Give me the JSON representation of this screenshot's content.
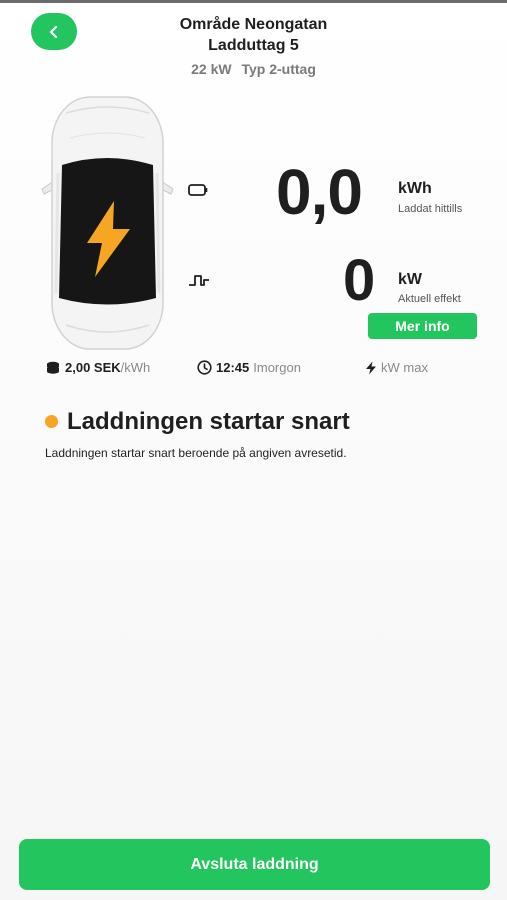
{
  "header": {
    "area": "Område Neongatan",
    "outlet": "Ladduttag 5",
    "power": "22 kW",
    "connector": "Typ 2-uttag"
  },
  "icons": {
    "back": "chevron-left-icon",
    "charged": "battery-icon",
    "power": "pulse-icon",
    "price": "coins-icon",
    "time": "clock-icon",
    "max": "bolt-icon",
    "car_status": "lightning-icon"
  },
  "energy": {
    "value": "0,0",
    "unit": "kWh",
    "label": "Laddat hittills"
  },
  "power": {
    "value": "0",
    "unit": "kW",
    "label": "Aktuell effekt"
  },
  "more_info_label": "Mer info",
  "info": {
    "price_value": "2,00 SEK",
    "price_unit": "/kWh",
    "time_value": "12:45",
    "time_day": "Imorgon",
    "max_label": "kW max"
  },
  "status": {
    "title": "Laddningen startar snart",
    "description": "Laddningen startar snart beroende på angiven avresetid."
  },
  "stop_button_label": "Avsluta laddning",
  "colors": {
    "accent": "#22c55e",
    "status_dot": "#f6a623",
    "bolt": "#f6a623"
  }
}
